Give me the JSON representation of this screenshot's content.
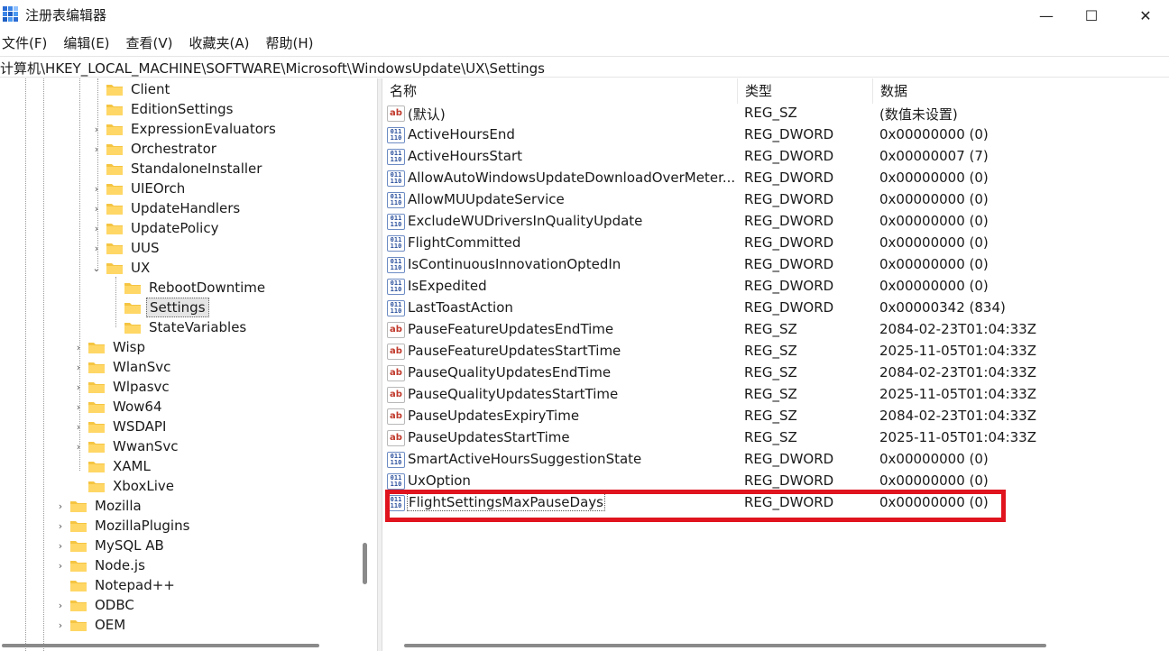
{
  "window": {
    "title": "注册表编辑器",
    "minimize": "—",
    "maximize": "☐",
    "close": "✕"
  },
  "menu": [
    "文件(F)",
    "编辑(E)",
    "查看(V)",
    "收藏夹(A)",
    "帮助(H)"
  ],
  "address": "计算机\\HKEY_LOCAL_MACHINE\\SOFTWARE\\Microsoft\\WindowsUpdate\\UX\\Settings",
  "tree": [
    {
      "label": "Client",
      "expander": ""
    },
    {
      "label": "EditionSettings",
      "expander": ""
    },
    {
      "label": "ExpressionEvaluators",
      "expander": "›"
    },
    {
      "label": "Orchestrator",
      "expander": "›"
    },
    {
      "label": "StandaloneInstaller",
      "expander": ""
    },
    {
      "label": "UIEOrch",
      "expander": "›"
    },
    {
      "label": "UpdateHandlers",
      "expander": "›"
    },
    {
      "label": "UpdatePolicy",
      "expander": "›"
    },
    {
      "label": "UUS",
      "expander": "›"
    },
    {
      "label": "UX",
      "expander": "⌄"
    },
    {
      "label": "RebootDowntime",
      "expander": ""
    },
    {
      "label": "Settings",
      "expander": ""
    },
    {
      "label": "StateVariables",
      "expander": ""
    },
    {
      "label": "Wisp",
      "expander": "›"
    },
    {
      "label": "WlanSvc",
      "expander": "›"
    },
    {
      "label": "Wlpasvc",
      "expander": "›"
    },
    {
      "label": "Wow64",
      "expander": "›"
    },
    {
      "label": "WSDAPI",
      "expander": "›"
    },
    {
      "label": "WwanSvc",
      "expander": "›"
    },
    {
      "label": "XAML",
      "expander": ""
    },
    {
      "label": "XboxLive",
      "expander": ""
    },
    {
      "label": "Mozilla",
      "expander": "›"
    },
    {
      "label": "MozillaPlugins",
      "expander": "›"
    },
    {
      "label": "MySQL AB",
      "expander": "›"
    },
    {
      "label": "Node.js",
      "expander": "›"
    },
    {
      "label": "Notepad++",
      "expander": ""
    },
    {
      "label": "ODBC",
      "expander": "›"
    },
    {
      "label": "OEM",
      "expander": "›"
    }
  ],
  "values": {
    "headers": {
      "name": "名称",
      "type": "类型",
      "data": "数据"
    },
    "rows": [
      {
        "icon": "string-value-icon",
        "name": "(默认)",
        "type": "REG_SZ",
        "data": "(数值未设置)"
      },
      {
        "icon": "dword-value-icon",
        "name": "ActiveHoursEnd",
        "type": "REG_DWORD",
        "data": "0x00000000 (0)"
      },
      {
        "icon": "dword-value-icon",
        "name": "ActiveHoursStart",
        "type": "REG_DWORD",
        "data": "0x00000007 (7)"
      },
      {
        "icon": "dword-value-icon",
        "name": "AllowAutoWindowsUpdateDownloadOverMeter...",
        "type": "REG_DWORD",
        "data": "0x00000000 (0)"
      },
      {
        "icon": "dword-value-icon",
        "name": "AllowMUUpdateService",
        "type": "REG_DWORD",
        "data": "0x00000000 (0)"
      },
      {
        "icon": "dword-value-icon",
        "name": "ExcludeWUDriversInQualityUpdate",
        "type": "REG_DWORD",
        "data": "0x00000000 (0)"
      },
      {
        "icon": "dword-value-icon",
        "name": "FlightCommitted",
        "type": "REG_DWORD",
        "data": "0x00000000 (0)"
      },
      {
        "icon": "dword-value-icon",
        "name": "IsContinuousInnovationOptedIn",
        "type": "REG_DWORD",
        "data": "0x00000000 (0)"
      },
      {
        "icon": "dword-value-icon",
        "name": "IsExpedited",
        "type": "REG_DWORD",
        "data": "0x00000000 (0)"
      },
      {
        "icon": "dword-value-icon",
        "name": "LastToastAction",
        "type": "REG_DWORD",
        "data": "0x00000342 (834)"
      },
      {
        "icon": "string-value-icon",
        "name": "PauseFeatureUpdatesEndTime",
        "type": "REG_SZ",
        "data": "2084-02-23T01:04:33Z"
      },
      {
        "icon": "string-value-icon",
        "name": "PauseFeatureUpdatesStartTime",
        "type": "REG_SZ",
        "data": "2025-11-05T01:04:33Z"
      },
      {
        "icon": "string-value-icon",
        "name": "PauseQualityUpdatesEndTime",
        "type": "REG_SZ",
        "data": "2084-02-23T01:04:33Z"
      },
      {
        "icon": "string-value-icon",
        "name": "PauseQualityUpdatesStartTime",
        "type": "REG_SZ",
        "data": "2025-11-05T01:04:33Z"
      },
      {
        "icon": "string-value-icon",
        "name": "PauseUpdatesExpiryTime",
        "type": "REG_SZ",
        "data": "2084-02-23T01:04:33Z"
      },
      {
        "icon": "string-value-icon",
        "name": "PauseUpdatesStartTime",
        "type": "REG_SZ",
        "data": "2025-11-05T01:04:33Z"
      },
      {
        "icon": "dword-value-icon",
        "name": "SmartActiveHoursSuggestionState",
        "type": "REG_DWORD",
        "data": "0x00000000 (0)"
      },
      {
        "icon": "dword-value-icon",
        "name": "UxOption",
        "type": "REG_DWORD",
        "data": "0x00000000 (0)"
      },
      {
        "icon": "dword-value-icon",
        "name": "FlightSettingsMaxPauseDays",
        "type": "REG_DWORD",
        "data": "0x00000000 (0)"
      }
    ]
  },
  "colors": {
    "highlight": "#e0141e",
    "folder": "#f5c542",
    "selected_bg": "#e5e5e5"
  },
  "icons": {
    "string": "ab",
    "dword": "011\n110"
  }
}
